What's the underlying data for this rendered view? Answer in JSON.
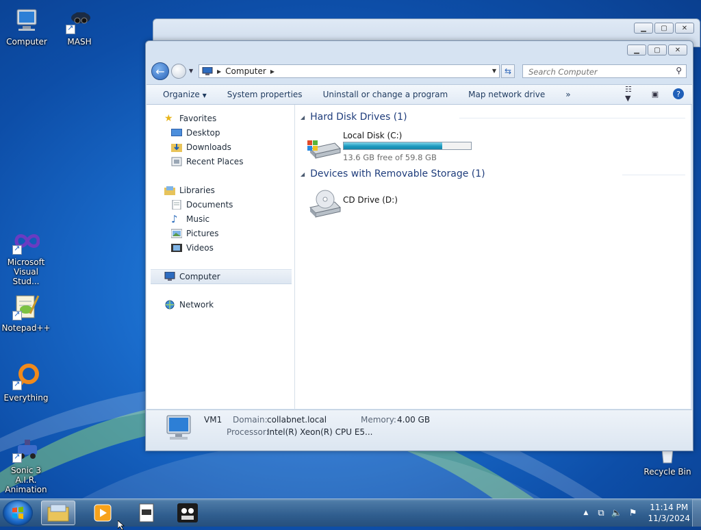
{
  "desktop": {
    "icons": [
      {
        "label": "Computer"
      },
      {
        "label": "MASH"
      },
      {
        "label": "Microsoft Visual Stud..."
      },
      {
        "label": "Notepad++"
      },
      {
        "label": "Everything"
      },
      {
        "label": "Sonic 3 A.I.R. Animation ..."
      },
      {
        "label": "Recycle Bin"
      }
    ]
  },
  "window": {
    "address": {
      "location": "Computer"
    },
    "search": {
      "placeholder": "Search Computer"
    },
    "toolbar": {
      "organize": "Organize",
      "system_properties": "System properties",
      "uninstall": "Uninstall or change a program",
      "map_drive": "Map network drive",
      "more": "»"
    },
    "nav": {
      "favorites": "Favorites",
      "desktop": "Desktop",
      "downloads": "Downloads",
      "recent": "Recent Places",
      "libraries": "Libraries",
      "documents": "Documents",
      "music": "Music",
      "pictures": "Pictures",
      "videos": "Videos",
      "computer": "Computer",
      "network": "Network"
    },
    "content": {
      "hdd_group": "Hard Disk Drives (1)",
      "local_disk_name": "Local Disk (C:)",
      "local_disk_used_fraction": 0.773,
      "local_disk_free": "13.6 GB free of 59.8 GB",
      "removable_group": "Devices with Removable Storage (1)",
      "cd_name": "CD Drive (D:)"
    },
    "details": {
      "name": "VM1",
      "domain_label": "Domain:",
      "domain_value": "collabnet.local",
      "memory_label": "Memory:",
      "memory_value": "4.00 GB",
      "processor_label": "Processor:",
      "processor_value": "Intel(R) Xeon(R) CPU E5..."
    }
  },
  "taskbar": {
    "time": "11:14 PM",
    "date": "11/3/2024"
  },
  "colors": {
    "accent": "#1e3c7b",
    "progress": "#1c9ac0"
  }
}
